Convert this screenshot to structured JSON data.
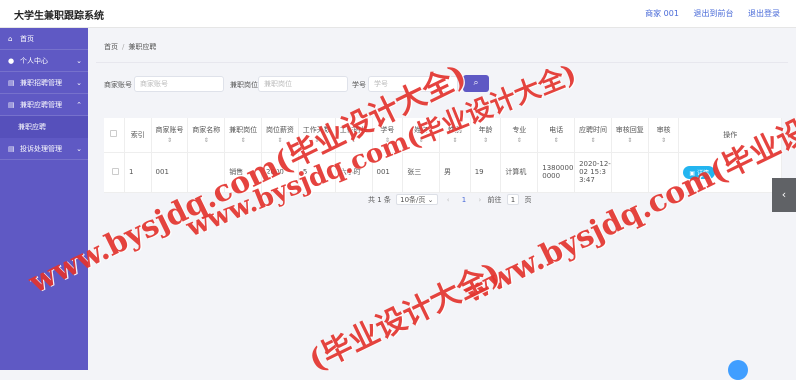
{
  "header": {
    "title": "大学生兼职跟踪系统",
    "user_label": "商家 001",
    "back_label": "退出到前台",
    "logout_label": "退出登录"
  },
  "sidebar": {
    "items": [
      {
        "label": "首页",
        "icon": "home-icon",
        "has_arrow": false
      },
      {
        "label": "个人中心",
        "icon": "user-icon",
        "has_arrow": true
      },
      {
        "label": "兼职招聘管理",
        "icon": "list-icon",
        "has_arrow": true
      },
      {
        "label": "兼职应聘管理",
        "icon": "list-icon",
        "has_arrow": true
      },
      {
        "label": "投诉处理管理",
        "icon": "list-icon",
        "has_arrow": true
      }
    ],
    "sub_item": "兼职应聘"
  },
  "breadcrumb": {
    "home": "首页",
    "sep": "/",
    "current": "兼职应聘"
  },
  "search": {
    "label1": "商家账号",
    "placeholder1": "商家账号",
    "label2": "兼职岗位",
    "placeholder2": "兼职岗位",
    "label3": "学号",
    "placeholder3": "学号"
  },
  "table": {
    "headers": [
      "索引",
      "商家账号",
      "商家名称",
      "兼职岗位",
      "岗位薪资",
      "工作天数",
      "工作时长",
      "学号",
      "姓名",
      "性别",
      "年龄",
      "专业",
      "电话",
      "应聘时间",
      "审核回复",
      "审核",
      "操作"
    ],
    "rows": [
      {
        "index": "1",
        "account": "001",
        "name": "",
        "position": "销售",
        "salary": "2000",
        "days": "5",
        "hours": "六小时",
        "student_no": "001",
        "student_name": "张三",
        "gender": "男",
        "age": "19",
        "major": "计算机",
        "phone": "13800000000",
        "time": "2020-12-02 15:33:47",
        "reply": "",
        "audit": "",
        "action": "详情"
      }
    ]
  },
  "pager": {
    "total": "共 1 条",
    "size": "10条/页",
    "page": "1",
    "goto": "前往",
    "goto_value": "1",
    "page_unit": "页"
  },
  "watermarks": [
    "www.bysjdq.com(毕业设计大全)",
    "www.bysjdq.com(毕业设计大全)",
    "www.bysjdq.com(毕业设计大全)",
    "(毕业设计大全)"
  ],
  "colors": {
    "sidebar": "#5f59c4",
    "accent": "#4a6bd8",
    "detail": "#23b5f0",
    "watermark": "#e3342f"
  }
}
